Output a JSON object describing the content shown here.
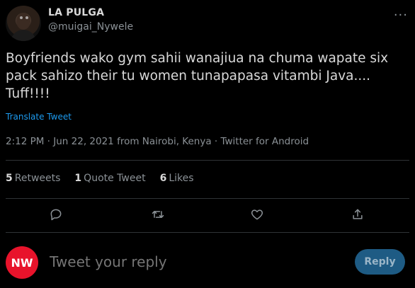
{
  "tweet": {
    "author_name": "LA PULGA",
    "author_handle": "@muigai_Nywele",
    "more_icon": "more-horizontal-icon",
    "text": "Boyfriends wako gym sahii wanajiua na chuma wapate six pack sahizo  their tu women tunapapasa vitambi Java.... Tuff!!!!",
    "translate_label": "Translate Tweet",
    "meta": "2:12 PM · Jun 22, 2021 from Nairobi, Kenya · Twitter for Android"
  },
  "stats": {
    "retweets_count": "5",
    "retweets_label": "Retweets",
    "quote_count": "1",
    "quote_label": "Quote Tweet",
    "likes_count": "6",
    "likes_label": "Likes"
  },
  "actions": [
    "reply-icon",
    "retweet-icon",
    "like-icon",
    "share-icon"
  ],
  "reply": {
    "avatar_text": "NW",
    "placeholder": "Tweet your reply",
    "button_label": "Reply"
  },
  "colors": {
    "background": "#000000",
    "accent": "#1d9bf0",
    "reply_button": "#1e5b84",
    "avatar_red": "#e8132b"
  }
}
